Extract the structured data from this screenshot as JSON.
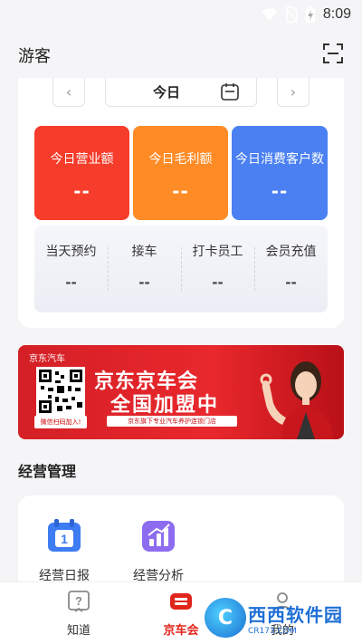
{
  "status_bar": {
    "time": "8:09"
  },
  "header": {
    "title": "游客"
  },
  "date_nav": {
    "prev": "‹",
    "label": "今日",
    "next": "›"
  },
  "stats": [
    {
      "label": "今日营业额",
      "value": "--",
      "color": "#f63c2a"
    },
    {
      "label": "今日毛利额",
      "value": "--",
      "color": "#ff8b26"
    },
    {
      "label": "今日消费客户数",
      "value": "--",
      "color": "#4a80f2"
    }
  ],
  "sub_stats": [
    {
      "label": "当天预约",
      "value": "--"
    },
    {
      "label": "接车",
      "value": "--"
    },
    {
      "label": "打卡员工",
      "value": "--"
    },
    {
      "label": "会员充值",
      "value": "--"
    }
  ],
  "banner": {
    "brand": "京东汽车",
    "qr_caption": "微信扫码加入!",
    "title_line1": "京东京车会",
    "title_line2": "全国加盟中",
    "strip": "京东旗下专业汽车养护连锁门店"
  },
  "management": {
    "title": "经营管理",
    "items": [
      {
        "label": "经营日报",
        "icon": "calendar-icon"
      },
      {
        "label": "经营分析",
        "icon": "bar-chart-icon"
      }
    ]
  },
  "bottom_nav": [
    {
      "label": "知道",
      "icon": "question-icon",
      "active": false
    },
    {
      "label": "京车会",
      "icon": "jd-car-icon",
      "active": true
    },
    {
      "label": "我的",
      "icon": "user-icon",
      "active": false
    }
  ],
  "watermark": {
    "logo": "C",
    "name": "西西软件园",
    "url": "CR173.COM"
  },
  "colors": {
    "accent": "#e1251b",
    "background": "#f5f5f7"
  }
}
